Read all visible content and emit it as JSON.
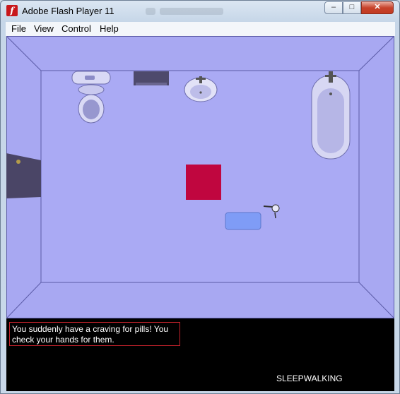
{
  "window": {
    "title": "Adobe Flash Player 11",
    "app_icon_glyph": "f"
  },
  "controls": {
    "minimize_glyph": "–",
    "maximize_glyph": "□",
    "close_glyph": "✕"
  },
  "menu": {
    "items": [
      {
        "label": "File"
      },
      {
        "label": "View"
      },
      {
        "label": "Control"
      },
      {
        "label": "Help"
      }
    ]
  },
  "game": {
    "message": "You suddenly have a craving for pills! You check your hands for them.",
    "hud_title": "SLEEPWALKING",
    "colors": {
      "floor": "#a8a8f2",
      "player": "#c0063f",
      "rug": "#7f9cf6",
      "door": "#4a4566",
      "message_border": "#c8232c"
    }
  }
}
